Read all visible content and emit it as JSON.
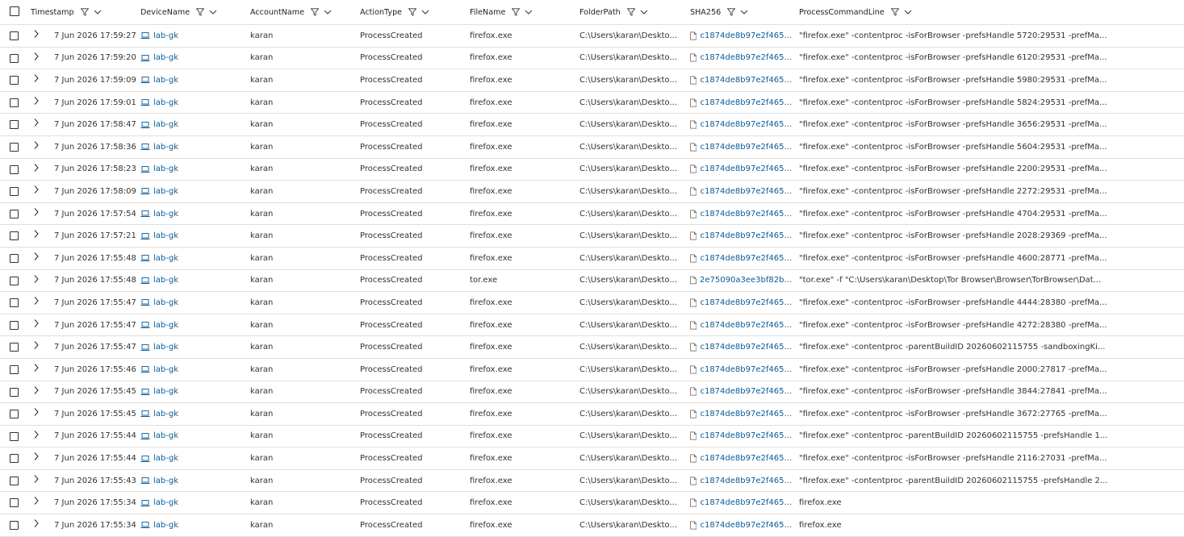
{
  "columns": {
    "timestamp": "Timestamp",
    "device": "DeviceName",
    "account": "AccountName",
    "action": "ActionType",
    "file": "FileName",
    "folder": "FolderPath",
    "sha": "SHA256",
    "cmd": "ProcessCommandLine"
  },
  "icons": {
    "header": [
      "filter-icon",
      "chevron-down-icon"
    ],
    "row": [
      "expand-chevron-icon",
      "laptop-icon",
      "file-icon"
    ]
  },
  "colors": {
    "link": "#0b5a95",
    "border": "#e1dfdd",
    "text": "#323130"
  },
  "rows": [
    {
      "ts": "7 Jun 2026 17:59:27",
      "device": "lab-gk",
      "account": "karan",
      "action": "ProcessCreated",
      "file": "firefox.exe",
      "folder": "C:\\Users\\karan\\Deskto...",
      "sha": "c1874de8b97e2f465...",
      "cmd": "\"firefox.exe\" -contentproc -isForBrowser -prefsHandle 5720:29531 -prefMa..."
    },
    {
      "ts": "7 Jun 2026 17:59:20",
      "device": "lab-gk",
      "account": "karan",
      "action": "ProcessCreated",
      "file": "firefox.exe",
      "folder": "C:\\Users\\karan\\Deskto...",
      "sha": "c1874de8b97e2f465...",
      "cmd": "\"firefox.exe\" -contentproc -isForBrowser -prefsHandle 6120:29531 -prefMa..."
    },
    {
      "ts": "7 Jun 2026 17:59:09",
      "device": "lab-gk",
      "account": "karan",
      "action": "ProcessCreated",
      "file": "firefox.exe",
      "folder": "C:\\Users\\karan\\Deskto...",
      "sha": "c1874de8b97e2f465...",
      "cmd": "\"firefox.exe\" -contentproc -isForBrowser -prefsHandle 5980:29531 -prefMa..."
    },
    {
      "ts": "7 Jun 2026 17:59:01",
      "device": "lab-gk",
      "account": "karan",
      "action": "ProcessCreated",
      "file": "firefox.exe",
      "folder": "C:\\Users\\karan\\Deskto...",
      "sha": "c1874de8b97e2f465...",
      "cmd": "\"firefox.exe\" -contentproc -isForBrowser -prefsHandle 5824:29531 -prefMa..."
    },
    {
      "ts": "7 Jun 2026 17:58:47",
      "device": "lab-gk",
      "account": "karan",
      "action": "ProcessCreated",
      "file": "firefox.exe",
      "folder": "C:\\Users\\karan\\Deskto...",
      "sha": "c1874de8b97e2f465...",
      "cmd": "\"firefox.exe\" -contentproc -isForBrowser -prefsHandle 3656:29531 -prefMa..."
    },
    {
      "ts": "7 Jun 2026 17:58:36",
      "device": "lab-gk",
      "account": "karan",
      "action": "ProcessCreated",
      "file": "firefox.exe",
      "folder": "C:\\Users\\karan\\Deskto...",
      "sha": "c1874de8b97e2f465...",
      "cmd": "\"firefox.exe\" -contentproc -isForBrowser -prefsHandle 5604:29531 -prefMa..."
    },
    {
      "ts": "7 Jun 2026 17:58:23",
      "device": "lab-gk",
      "account": "karan",
      "action": "ProcessCreated",
      "file": "firefox.exe",
      "folder": "C:\\Users\\karan\\Deskto...",
      "sha": "c1874de8b97e2f465...",
      "cmd": "\"firefox.exe\" -contentproc -isForBrowser -prefsHandle 2200:29531 -prefMa..."
    },
    {
      "ts": "7 Jun 2026 17:58:09",
      "device": "lab-gk",
      "account": "karan",
      "action": "ProcessCreated",
      "file": "firefox.exe",
      "folder": "C:\\Users\\karan\\Deskto...",
      "sha": "c1874de8b97e2f465...",
      "cmd": "\"firefox.exe\" -contentproc -isForBrowser -prefsHandle 2272:29531 -prefMa..."
    },
    {
      "ts": "7 Jun 2026 17:57:54",
      "device": "lab-gk",
      "account": "karan",
      "action": "ProcessCreated",
      "file": "firefox.exe",
      "folder": "C:\\Users\\karan\\Deskto...",
      "sha": "c1874de8b97e2f465...",
      "cmd": "\"firefox.exe\" -contentproc -isForBrowser -prefsHandle 4704:29531 -prefMa..."
    },
    {
      "ts": "7 Jun 2026 17:57:21",
      "device": "lab-gk",
      "account": "karan",
      "action": "ProcessCreated",
      "file": "firefox.exe",
      "folder": "C:\\Users\\karan\\Deskto...",
      "sha": "c1874de8b97e2f465...",
      "cmd": "\"firefox.exe\" -contentproc -isForBrowser -prefsHandle 2028:29369 -prefMa..."
    },
    {
      "ts": "7 Jun 2026 17:55:48",
      "device": "lab-gk",
      "account": "karan",
      "action": "ProcessCreated",
      "file": "firefox.exe",
      "folder": "C:\\Users\\karan\\Deskto...",
      "sha": "c1874de8b97e2f465...",
      "cmd": "\"firefox.exe\" -contentproc -isForBrowser -prefsHandle 4600:28771 -prefMa..."
    },
    {
      "ts": "7 Jun 2026 17:55:48",
      "device": "lab-gk",
      "account": "karan",
      "action": "ProcessCreated",
      "file": "tor.exe",
      "folder": "C:\\Users\\karan\\Deskto...",
      "sha": "2e75090a3ee3bf82b...",
      "cmd": "\"tor.exe\" -f \"C:\\Users\\karan\\Desktop\\Tor Browser\\Browser\\TorBrowser\\Dat..."
    },
    {
      "ts": "7 Jun 2026 17:55:47",
      "device": "lab-gk",
      "account": "karan",
      "action": "ProcessCreated",
      "file": "firefox.exe",
      "folder": "C:\\Users\\karan\\Deskto...",
      "sha": "c1874de8b97e2f465...",
      "cmd": "\"firefox.exe\" -contentproc -isForBrowser -prefsHandle 4444:28380 -prefMa..."
    },
    {
      "ts": "7 Jun 2026 17:55:47",
      "device": "lab-gk",
      "account": "karan",
      "action": "ProcessCreated",
      "file": "firefox.exe",
      "folder": "C:\\Users\\karan\\Deskto...",
      "sha": "c1874de8b97e2f465...",
      "cmd": "\"firefox.exe\" -contentproc -isForBrowser -prefsHandle 4272:28380 -prefMa..."
    },
    {
      "ts": "7 Jun 2026 17:55:47",
      "device": "lab-gk",
      "account": "karan",
      "action": "ProcessCreated",
      "file": "firefox.exe",
      "folder": "C:\\Users\\karan\\Deskto...",
      "sha": "c1874de8b97e2f465...",
      "cmd": "\"firefox.exe\" -contentproc -parentBuildID 20260602115755 -sandboxingKi..."
    },
    {
      "ts": "7 Jun 2026 17:55:46",
      "device": "lab-gk",
      "account": "karan",
      "action": "ProcessCreated",
      "file": "firefox.exe",
      "folder": "C:\\Users\\karan\\Deskto...",
      "sha": "c1874de8b97e2f465...",
      "cmd": "\"firefox.exe\" -contentproc -isForBrowser -prefsHandle 2000:27817 -prefMa..."
    },
    {
      "ts": "7 Jun 2026 17:55:45",
      "device": "lab-gk",
      "account": "karan",
      "action": "ProcessCreated",
      "file": "firefox.exe",
      "folder": "C:\\Users\\karan\\Deskto...",
      "sha": "c1874de8b97e2f465...",
      "cmd": "\"firefox.exe\" -contentproc -isForBrowser -prefsHandle 3844:27841 -prefMa..."
    },
    {
      "ts": "7 Jun 2026 17:55:45",
      "device": "lab-gk",
      "account": "karan",
      "action": "ProcessCreated",
      "file": "firefox.exe",
      "folder": "C:\\Users\\karan\\Deskto...",
      "sha": "c1874de8b97e2f465...",
      "cmd": "\"firefox.exe\" -contentproc -isForBrowser -prefsHandle 3672:27765 -prefMa..."
    },
    {
      "ts": "7 Jun 2026 17:55:44",
      "device": "lab-gk",
      "account": "karan",
      "action": "ProcessCreated",
      "file": "firefox.exe",
      "folder": "C:\\Users\\karan\\Deskto...",
      "sha": "c1874de8b97e2f465...",
      "cmd": "\"firefox.exe\" -contentproc -parentBuildID 20260602115755 -prefsHandle 1..."
    },
    {
      "ts": "7 Jun 2026 17:55:44",
      "device": "lab-gk",
      "account": "karan",
      "action": "ProcessCreated",
      "file": "firefox.exe",
      "folder": "C:\\Users\\karan\\Deskto...",
      "sha": "c1874de8b97e2f465...",
      "cmd": "\"firefox.exe\" -contentproc -isForBrowser -prefsHandle 2116:27031 -prefMa..."
    },
    {
      "ts": "7 Jun 2026 17:55:43",
      "device": "lab-gk",
      "account": "karan",
      "action": "ProcessCreated",
      "file": "firefox.exe",
      "folder": "C:\\Users\\karan\\Deskto...",
      "sha": "c1874de8b97e2f465...",
      "cmd": "\"firefox.exe\" -contentproc -parentBuildID 20260602115755 -prefsHandle 2..."
    },
    {
      "ts": "7 Jun 2026 17:55:34",
      "device": "lab-gk",
      "account": "karan",
      "action": "ProcessCreated",
      "file": "firefox.exe",
      "folder": "C:\\Users\\karan\\Deskto...",
      "sha": "c1874de8b97e2f465...",
      "cmd": "firefox.exe"
    },
    {
      "ts": "7 Jun 2026 17:55:34",
      "device": "lab-gk",
      "account": "karan",
      "action": "ProcessCreated",
      "file": "firefox.exe",
      "folder": "C:\\Users\\karan\\Deskto...",
      "sha": "c1874de8b97e2f465...",
      "cmd": "firefox.exe"
    }
  ]
}
